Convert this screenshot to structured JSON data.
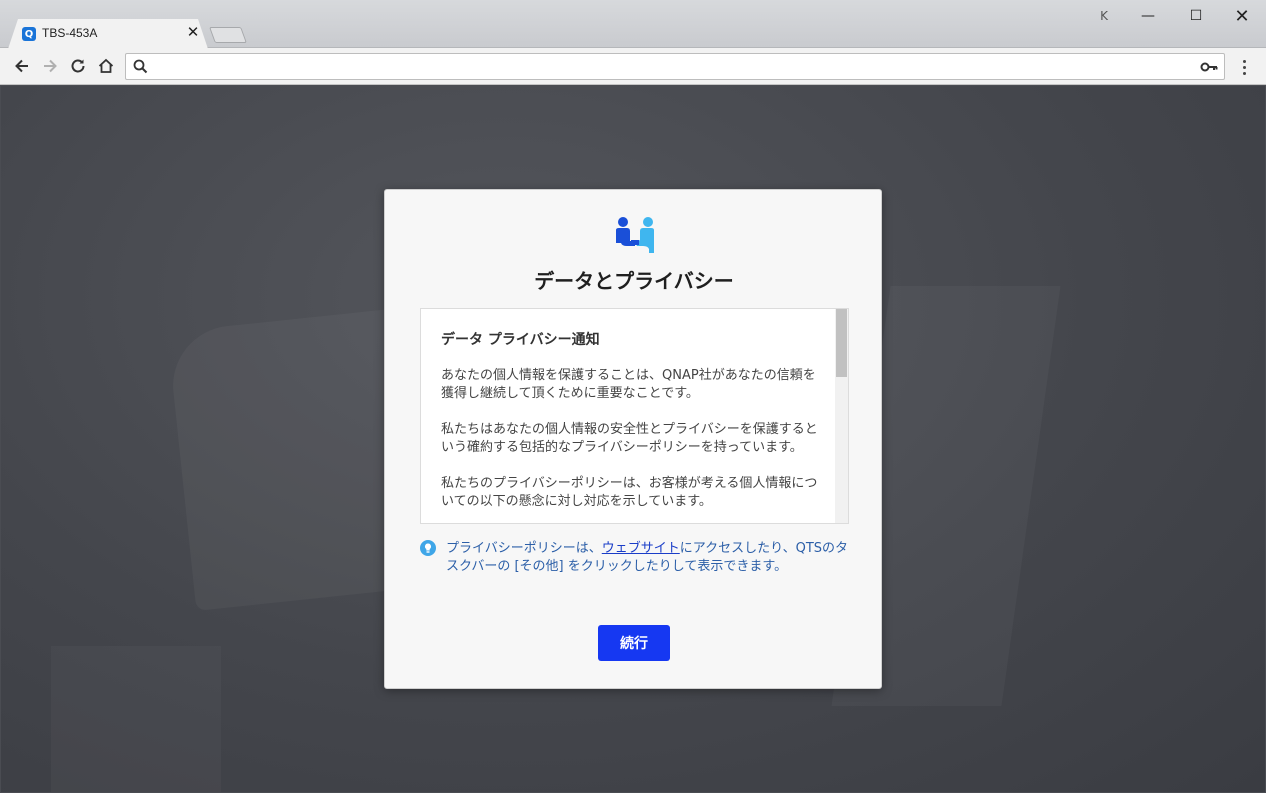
{
  "browser": {
    "tab_title": "TBS-453A",
    "tab_close": "✕",
    "favicon_letter": "Q",
    "window_min": "—",
    "window_max": "☐",
    "window_close": "✕",
    "window_user": "K",
    "address_value": "",
    "icons": {
      "back": "arrow-left-icon",
      "forward": "arrow-right-icon",
      "reload": "reload-icon",
      "home": "home-icon",
      "search": "search-icon",
      "key": "key-icon",
      "menu": "kebab-menu-icon"
    }
  },
  "dialog": {
    "title": "データとプライバシー",
    "notice": {
      "heading": "データ プライバシー通知",
      "paragraphs": [
        "あなたの個人情報を保護することは、QNAP社があなたの信頼を獲得し継続して頂くために重要なことです。",
        "私たちはあなたの個人情報の安全性とプライバシーを保護するという確約する包括的なプライバシーポリシーを持っています。",
        "私たちのプライバシーポリシーは、お客様が考える個人情報についての以下の懸念に対し対応を示しています。"
      ]
    },
    "info": {
      "prefix": "プライバシーポリシーは、",
      "link": "ウェブサイト",
      "suffix": "にアクセスしたり、QTSのタスクバーの [その他] をクリックしたりして表示できます。"
    },
    "continue_label": "続行"
  },
  "colors": {
    "accent": "#1638f2",
    "info_text": "#2c5fa8",
    "icon_blue_dark": "#1a4fd8",
    "icon_blue_light": "#3fb6ef"
  }
}
